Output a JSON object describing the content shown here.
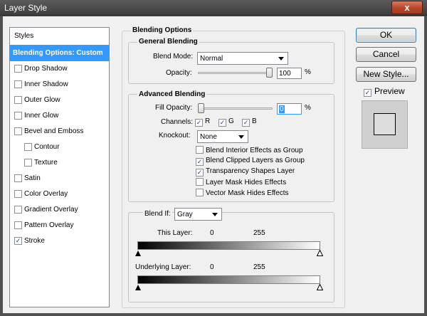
{
  "window": {
    "title": "Layer Style",
    "close_label": "x"
  },
  "styles_panel": {
    "header": "Styles",
    "items": [
      {
        "label": "Blending Options: Custom",
        "selected": true,
        "has_checkbox": false,
        "checked": false,
        "indent": false
      },
      {
        "label": "Drop Shadow",
        "selected": false,
        "has_checkbox": true,
        "checked": false,
        "indent": false
      },
      {
        "label": "Inner Shadow",
        "selected": false,
        "has_checkbox": true,
        "checked": false,
        "indent": false
      },
      {
        "label": "Outer Glow",
        "selected": false,
        "has_checkbox": true,
        "checked": false,
        "indent": false
      },
      {
        "label": "Inner Glow",
        "selected": false,
        "has_checkbox": true,
        "checked": false,
        "indent": false
      },
      {
        "label": "Bevel and Emboss",
        "selected": false,
        "has_checkbox": true,
        "checked": false,
        "indent": false
      },
      {
        "label": "Contour",
        "selected": false,
        "has_checkbox": true,
        "checked": false,
        "indent": true
      },
      {
        "label": "Texture",
        "selected": false,
        "has_checkbox": true,
        "checked": false,
        "indent": true
      },
      {
        "label": "Satin",
        "selected": false,
        "has_checkbox": true,
        "checked": false,
        "indent": false
      },
      {
        "label": "Color Overlay",
        "selected": false,
        "has_checkbox": true,
        "checked": false,
        "indent": false
      },
      {
        "label": "Gradient Overlay",
        "selected": false,
        "has_checkbox": true,
        "checked": false,
        "indent": false
      },
      {
        "label": "Pattern Overlay",
        "selected": false,
        "has_checkbox": true,
        "checked": false,
        "indent": false
      },
      {
        "label": "Stroke",
        "selected": false,
        "has_checkbox": true,
        "checked": true,
        "indent": false
      }
    ]
  },
  "buttons": {
    "ok": "OK",
    "cancel": "Cancel",
    "new_style": "New Style..."
  },
  "preview": {
    "label": "Preview",
    "checked": true
  },
  "blending_options": {
    "title": "Blending Options",
    "general": {
      "title": "General Blending",
      "blend_mode_label": "Blend Mode:",
      "blend_mode_value": "Normal",
      "opacity_label": "Opacity:",
      "opacity_value": "100",
      "opacity_unit": "%",
      "opacity_fraction": 1.0
    },
    "advanced": {
      "title": "Advanced Blending",
      "fill_opacity_label": "Fill Opacity:",
      "fill_opacity_value": "0",
      "fill_opacity_unit": "%",
      "fill_opacity_fraction": 0.0,
      "channels_label": "Channels:",
      "channels": [
        {
          "label": "R",
          "checked": true
        },
        {
          "label": "G",
          "checked": true
        },
        {
          "label": "B",
          "checked": true
        }
      ],
      "knockout_label": "Knockout:",
      "knockout_value": "None",
      "options": [
        {
          "label": "Blend Interior Effects as Group",
          "checked": false
        },
        {
          "label": "Blend Clipped Layers as Group",
          "checked": true
        },
        {
          "label": "Transparency Shapes Layer",
          "checked": true
        },
        {
          "label": "Layer Mask Hides Effects",
          "checked": false
        },
        {
          "label": "Vector Mask Hides Effects",
          "checked": false
        }
      ]
    },
    "blend_if": {
      "label": "Blend If:",
      "value": "Gray",
      "this_layer_label": "This Layer:",
      "this_layer_low": "0",
      "this_layer_high": "255",
      "underlying_label": "Underlying Layer:",
      "underlying_low": "0",
      "underlying_high": "255"
    }
  },
  "colors": {
    "selection": "#3399ff",
    "check": "#21438d",
    "dialog_bg": "#f0f0f0"
  }
}
